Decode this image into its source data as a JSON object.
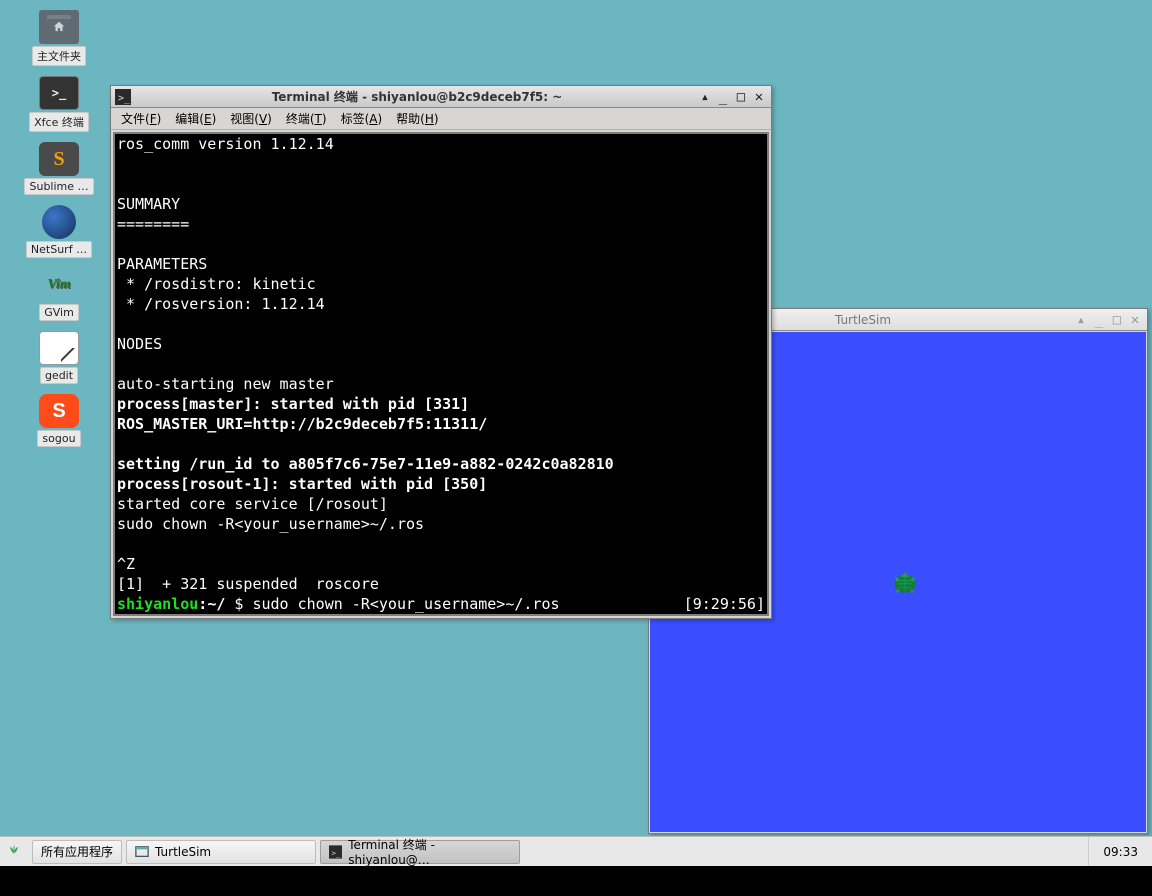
{
  "desktop": {
    "icons": [
      {
        "name": "home-folder",
        "label": "主文件夹"
      },
      {
        "name": "xfce-terminal",
        "label": "Xfce 终端"
      },
      {
        "name": "sublime",
        "label": "Sublime …"
      },
      {
        "name": "netsurf",
        "label": "NetSurf …"
      },
      {
        "name": "gvim",
        "label": "GVim"
      },
      {
        "name": "gedit",
        "label": "gedit"
      },
      {
        "name": "sogou",
        "label": "sogou"
      }
    ]
  },
  "terminal": {
    "title": "Terminal 终端 - shiyanlou@b2c9deceb7f5: ~",
    "menu": [
      "文件(F)",
      "编辑(E)",
      "视图(V)",
      "终端(T)",
      "标签(A)",
      "帮助(H)"
    ],
    "lines": [
      {
        "t": "ros_comm version 1.12.14"
      },
      {
        "t": ""
      },
      {
        "t": ""
      },
      {
        "t": "SUMMARY"
      },
      {
        "t": "========"
      },
      {
        "t": ""
      },
      {
        "t": "PARAMETERS"
      },
      {
        "t": " * /rosdistro: kinetic"
      },
      {
        "t": " * /rosversion: 1.12.14"
      },
      {
        "t": ""
      },
      {
        "t": "NODES"
      },
      {
        "t": ""
      },
      {
        "t": "auto-starting new master"
      },
      {
        "t": "process[master]: started with pid [331]",
        "b": true
      },
      {
        "t": "ROS_MASTER_URI=http://b2c9deceb7f5:11311/",
        "b": true
      },
      {
        "t": ""
      },
      {
        "t": "setting /run_id to a805f7c6-75e7-11e9-a882-0242c0a82810",
        "b": true
      },
      {
        "t": "process[rosout-1]: started with pid [350]",
        "b": true
      },
      {
        "t": "started core service [/rosout]"
      },
      {
        "t": "sudo chown -R<your_username>~/.ros"
      },
      {
        "t": ""
      },
      {
        "t": "^Z"
      },
      {
        "t": "[1]  + 321 suspended  roscore"
      }
    ],
    "prompt": {
      "user": "shiyanlou",
      "sep": ":",
      "cwd": "~/",
      "cmd": " $ sudo chown -R<your_username>~/.ros",
      "clock": "[9:29:56]"
    }
  },
  "turtlesim": {
    "title": "TurtleSim"
  },
  "taskbar": {
    "menu": "所有应用程序",
    "items": [
      {
        "name": "task-turtlesim",
        "label": "TurtleSim",
        "active": false
      },
      {
        "name": "task-terminal",
        "label": "Terminal 终端 - shiyanlou@…",
        "active": true
      }
    ],
    "clock": "09:33"
  }
}
